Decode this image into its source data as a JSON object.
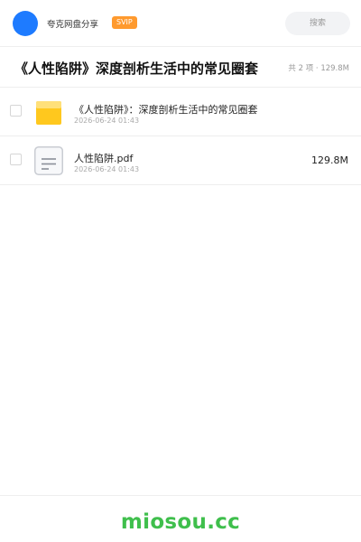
{
  "header": {
    "app_title": "夸克网盘分享",
    "badge": "SVIP",
    "search_placeholder": "搜索"
  },
  "folder": {
    "title": "《人性陷阱》深度剖析生活中的常见圈套",
    "summary": "共 2 项 · 129.8M"
  },
  "files": [
    {
      "name": "《人性陷阱》：深度剖析生活中的常见圈套",
      "date": "2026-06-24 01:43",
      "size": "",
      "icon": "folder-icon"
    },
    {
      "name": "人性陷阱.pdf",
      "date": "2026-06-24 01:43",
      "size": "129.8M",
      "icon": "document-icon"
    }
  ],
  "footer": {
    "brand": "miosou.cc"
  },
  "colors": {
    "accent_blue": "#1e7bff",
    "badge_orange": "#ff9a2e",
    "folder_yellow": "#ffc81e",
    "brand_green": "#3fbf4c"
  }
}
